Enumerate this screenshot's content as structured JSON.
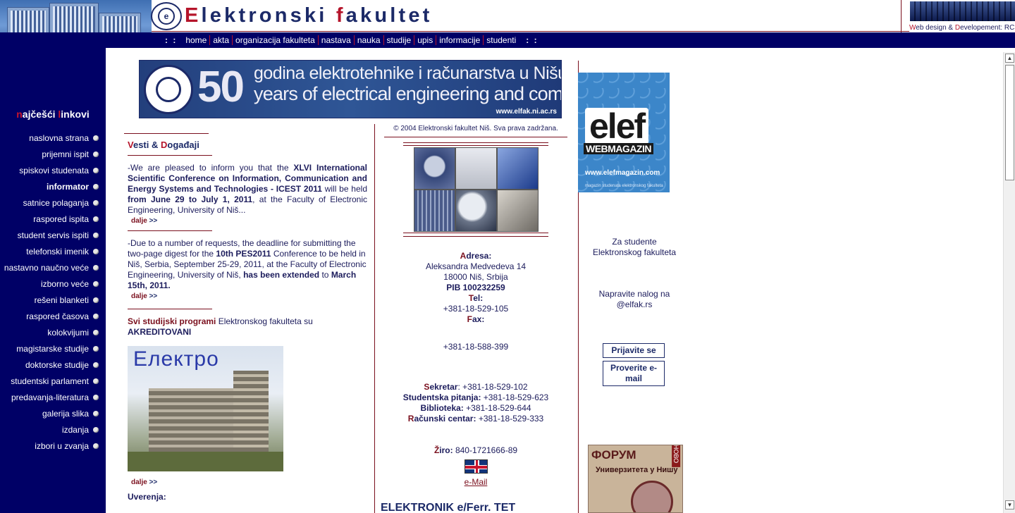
{
  "header": {
    "title_parts": [
      {
        "text": "E",
        "red": true
      },
      {
        "text": "lektronski ",
        "red": false
      },
      {
        "text": "f",
        "red": true
      },
      {
        "text": "akultet",
        "red": false
      }
    ],
    "credit": {
      "a": "W",
      "b": "eb design & ",
      "c": "D",
      "d": "evelopement: RC"
    }
  },
  "nav": {
    "dots_left": ": :",
    "dots_right": ": :",
    "items": [
      "home",
      "akta",
      "organizacija fakulteta",
      "nastava",
      "nauka",
      "studije",
      "upis",
      "informacije",
      "studenti"
    ]
  },
  "sidebar": {
    "heading": {
      "a": "n",
      "b": "ajčešći ",
      "c": "l",
      "d": "inkovi"
    },
    "items": [
      {
        "label": "naslovna strana",
        "bold": false
      },
      {
        "label": "prijemni ispit",
        "bold": false
      },
      {
        "label": "spiskovi studenata",
        "bold": false
      },
      {
        "label": "informator",
        "bold": true
      },
      {
        "label": "satnice polaganja",
        "bold": false
      },
      {
        "label": "raspored ispita",
        "bold": false
      },
      {
        "label": "student servis ispiti",
        "bold": false
      },
      {
        "label": "telefonski imenik",
        "bold": false
      },
      {
        "label": "nastavno naučno veće",
        "bold": false
      },
      {
        "label": "izborno veće",
        "bold": false
      },
      {
        "label": "rešeni blanketi",
        "bold": false
      },
      {
        "label": "raspored časova",
        "bold": false
      },
      {
        "label": "kolokvijumi",
        "bold": false
      },
      {
        "label": "magistarske studije",
        "bold": false
      },
      {
        "label": "doktorske studije",
        "bold": false
      },
      {
        "label": "studentski parlament",
        "bold": false
      },
      {
        "label": "predavanja-literatura",
        "bold": false
      },
      {
        "label": "galerija slika",
        "bold": false
      },
      {
        "label": "izdanja",
        "bold": false
      },
      {
        "label": "izbori u zvanja",
        "bold": false
      }
    ]
  },
  "banner": {
    "number": "50",
    "line1": "godina elektrotehnike i računarstva  u Nišu",
    "line2": "years of electrical engineering and computing in Niš",
    "url": "www.elfak.ni.ac.rs"
  },
  "news": {
    "heading": {
      "a": "V",
      "b": "esti & ",
      "c": "D",
      "d": "ogađaji"
    },
    "item1": {
      "t1": "-We are pleased to inform you that the ",
      "b1": "XLVI International Scientific Conference on Information, Communication and Energy Systems and Technologies - ICEST 2011",
      "t2": " will be held ",
      "b2": "from June 29 to July 1, 2011",
      "t3": ", at the Faculty of Electronic Engineering, University of Niš..."
    },
    "item2": {
      "t1": "-Due to a number of requests, the deadline for submitting the two-page digest for the ",
      "b1": "10th PES2011",
      "t2": " Conference to be held in Niš, Serbia, September 25-29, 2011, at the Faculty of Electronic Engineering, University of Niš, ",
      "b2": "has been extended",
      "t3": " to ",
      "b3": "March 15th, 2011."
    },
    "dalje": "dalje",
    "arrows": ">>",
    "programs": {
      "red": "Svi studijski programi",
      "normal": " Elektronskog fakulteta su ",
      "bold": "AKREDITOVANI"
    },
    "photo_text": "Електро",
    "uverenja": "Uverenja:"
  },
  "center": {
    "copyright": "© 2004 Elektronski fakultet Niš. Sva prava zadržana.",
    "adresa_label": {
      "a": "A",
      "b": "dresa:"
    },
    "address1": "Aleksandra Medvedeva 14",
    "address2": "18000 Niš, Srbija",
    "pib": "PIB 100232259",
    "tel_label": {
      "a": "T",
      "b": "el:"
    },
    "tel": "+381-18-529-105",
    "fax_label": {
      "a": "F",
      "b": "ax:"
    },
    "fax": "+381-18-588-399",
    "sekretar": {
      "a": "S",
      "b": "ekretar",
      ":": ": ",
      "v": "+381-18-529-102"
    },
    "studentska": {
      "label": "Studentska pitanja:",
      "v": " +381-18-529-623"
    },
    "biblioteka": {
      "label": "Biblioteka:",
      "v": " +381-18-529-644"
    },
    "racunski": {
      "a": "R",
      "b": "ačunski centar:",
      "v": " +381-18-529-333"
    },
    "ziro": {
      "a": "Ž",
      "b": "iro:",
      "v": " 840-1721666-89"
    },
    "email": "e-Mail",
    "bottom_text": "ELEKTRONIK  e/Ferr.  TET"
  },
  "right": {
    "elef_word": "elef",
    "elef_sub": "WEBMAGAZIN",
    "elef_url": "www.elefmagazin.com",
    "elef_tiny": "magazin studenata elektronskog fakulteta",
    "students1": "Za studente",
    "students2": "Elektronskog fakulteta",
    "account1": "Napravite nalog na",
    "account2": "@elfak.rs",
    "login": "Prijavite se",
    "check": "Proverite e-mail",
    "forum_title": "ФОРУМ",
    "forum_sub": "Универзитета у Нишу",
    "forum_novo": "НОВО"
  },
  "colors": {
    "navy": "#000066",
    "accent_red": "#b5142a",
    "dark_red": "#7a0f1d"
  }
}
